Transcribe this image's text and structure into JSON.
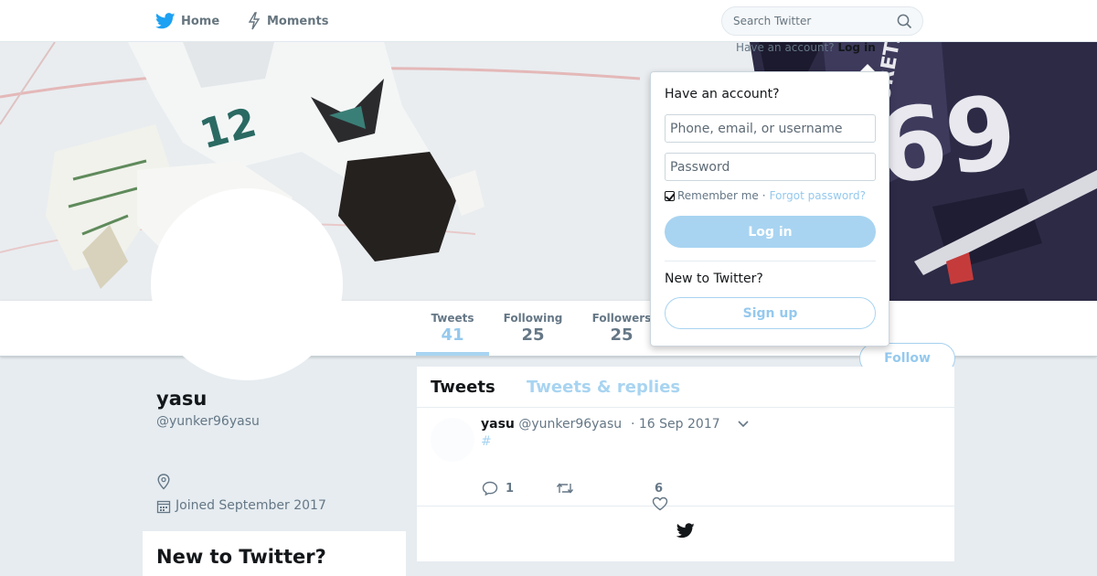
{
  "nav": {
    "home_label": "Home",
    "moments_label": "Moments",
    "search_placeholder": "Search Twitter"
  },
  "header": {
    "have_account_text": "Have an account?",
    "login_link": "Log in"
  },
  "profile": {
    "name": "yasu",
    "handle": "@yunker96yasu",
    "joined": "Joined September 2017",
    "follow_label": "Follow"
  },
  "stats": [
    {
      "label": "Tweets",
      "value": "41"
    },
    {
      "label": "Following",
      "value": "25"
    },
    {
      "label": "Followers",
      "value": "25"
    }
  ],
  "timeline": {
    "tabs": [
      "Tweets",
      "Tweets & replies"
    ],
    "tweet": {
      "author": "yasu",
      "handle": "@yunker96yasu",
      "date": "· 16 Sep 2017",
      "text": "#",
      "reply_count": "1",
      "like_count": "6"
    }
  },
  "login_dropdown": {
    "title": "Have an account?",
    "username_placeholder": "Phone, email, or username",
    "password_placeholder": "Password",
    "remember_label": "Remember me",
    "separator": "·",
    "forgot_label": "Forgot password?",
    "login_button": "Log in",
    "new_label": "New to Twitter?",
    "signup_button": "Sign up"
  },
  "sidebar": {
    "new_card_title": "New to Twitter?"
  },
  "icons": {
    "brand": "twitter-bird-icon",
    "moments": "lightning-icon",
    "search": "magnifier-icon",
    "location": "location-pin-icon",
    "calendar": "calendar-icon",
    "reply": "reply-bubble-icon",
    "retweet": "retweet-icon",
    "like": "heart-icon",
    "caret": "chevron-down-icon"
  },
  "colors": {
    "brand_blue": "#1da1f2",
    "light_blue": "#a8d4f1",
    "background": "#e6ecf0"
  }
}
